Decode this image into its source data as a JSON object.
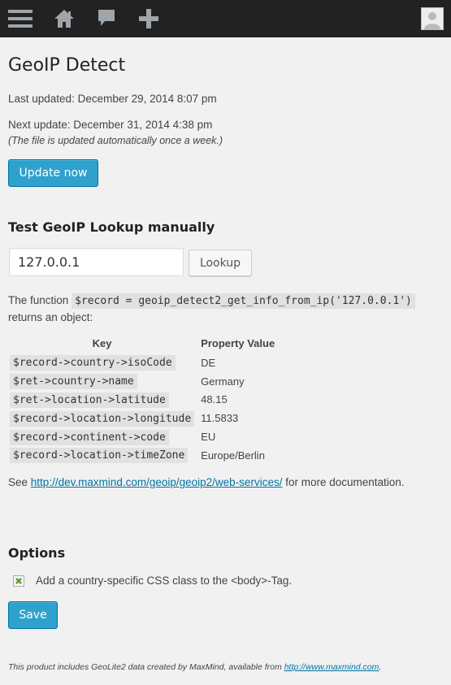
{
  "adminbar": {
    "menu_icon": "hamburger-menu-icon",
    "home_icon": "home-icon",
    "comments_icon": "comment-bubble-icon",
    "new_icon": "plus-icon",
    "avatar_icon": "user-avatar-icon"
  },
  "page": {
    "title": "GeoIP Detect",
    "last_updated": "Last updated: December 29, 2014 8:07 pm",
    "next_update": "Next update: December 31, 2014 4:38 pm",
    "auto_note": "(The file is updated automatically once a week.)",
    "update_button": "Update now"
  },
  "lookup": {
    "heading": "Test GeoIP Lookup manually",
    "ip_value": "127.0.0.1",
    "button": "Lookup",
    "text_before": "The function",
    "function_code": "$record = geoip_detect2_get_info_from_ip('127.0.0.1')",
    "text_after": "returns an object:"
  },
  "results": {
    "headers": [
      "Key",
      "Property Value"
    ],
    "rows": [
      {
        "key": "$record->country->isoCode",
        "value": "DE"
      },
      {
        "key": "$ret->country->name",
        "value": "Germany"
      },
      {
        "key": "$ret->location->latitude",
        "value": "48.15"
      },
      {
        "key": "$record->location->longitude",
        "value": "11.5833"
      },
      {
        "key": "$record->continent->code",
        "value": "EU"
      },
      {
        "key": "$record->location->timeZone",
        "value": "Europe/Berlin"
      }
    ]
  },
  "docs": {
    "before": "See",
    "link": "http://dev.maxmind.com/geoip/geoip2/web-services/",
    "after": "for more documentation."
  },
  "options": {
    "heading": "Options",
    "checkbox_label": "Add a country-specific CSS class to the <body>-Tag.",
    "save_button": "Save"
  },
  "footer": {
    "text": "This product includes GeoLite2 data created by MaxMind, available from",
    "link": "http://www.maxmind.com",
    "end": "."
  },
  "colors": {
    "adminbar_bg": "#222222",
    "primary_button": "#2ea2cc",
    "link": "#0074a2",
    "page_bg": "#f1f1f1"
  }
}
